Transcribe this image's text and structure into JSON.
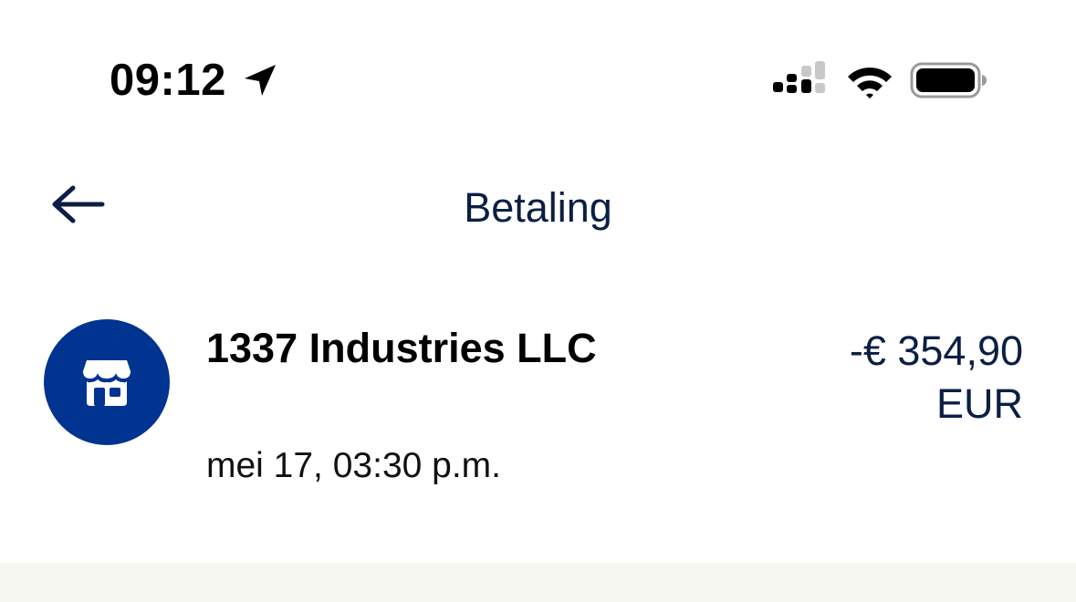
{
  "status_bar": {
    "time": "09:12",
    "icons": [
      "location-arrow-icon",
      "cellular-signal-icon",
      "wifi-icon",
      "battery-icon"
    ]
  },
  "header": {
    "title": "Betaling",
    "back_icon": "arrow-left-icon"
  },
  "transaction": {
    "merchant_name": "1337 Industries LLC",
    "merchant_icon": "store-icon",
    "amount_value": "-€ 354,90",
    "currency": "EUR",
    "datetime": "mei 17, 03:30 p.m."
  },
  "colors": {
    "brand": "#013391",
    "title_text": "#0b1f44",
    "band": "#f7f7f2"
  }
}
